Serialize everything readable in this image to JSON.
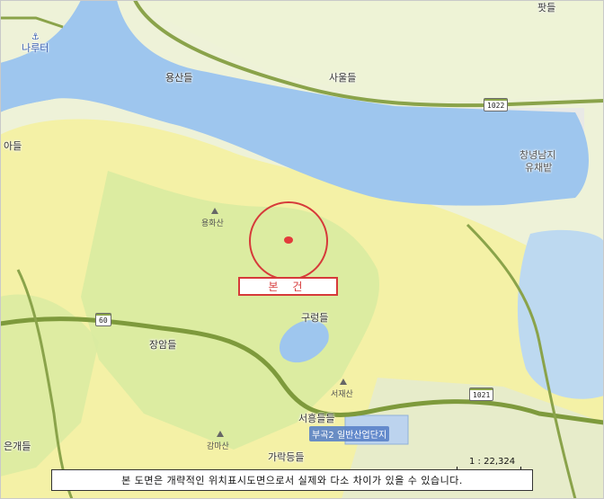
{
  "map": {
    "colors": {
      "river": "#9ec6ee",
      "lowland": "#eef2d8",
      "forest_light": "#f4f1a6",
      "forest_mid": "#d9eba1",
      "park": "#cfe3a8",
      "road": "#8aa34a",
      "road_major": "#7e9a3c",
      "subject_marker": "#e23b3b",
      "subject_ring": "#d63a3a"
    },
    "places": [
      {
        "name": "나루터",
        "kind": "ferry"
      },
      {
        "name": "용산들"
      },
      {
        "name": "사울들"
      },
      {
        "name": "창녕남지"
      },
      {
        "name": "유채밭"
      },
      {
        "name": "아들"
      },
      {
        "name": "구렁들"
      },
      {
        "name": "장암들"
      },
      {
        "name": "서흥들들"
      },
      {
        "name": "가락등들"
      },
      {
        "name": "은개들"
      },
      {
        "name": "감마산"
      },
      {
        "name": "서재산"
      },
      {
        "name": "용화산"
      },
      {
        "name": "팟들"
      }
    ],
    "mountains": {
      "yonghwa": "용화산",
      "seojae": "서재산",
      "gamma": "감마산"
    },
    "roads": {
      "r1022": "1022",
      "r60": "60",
      "r1021": "1021"
    },
    "industrial_complex": "부곡2 일반산업단지",
    "subject_label": "본 건",
    "scale_text": "1 : 22,324",
    "disclaimer": "본 도면은 개략적인 위치표시도면으로서 실제와 다소 차이가 있을 수 있습니다."
  }
}
